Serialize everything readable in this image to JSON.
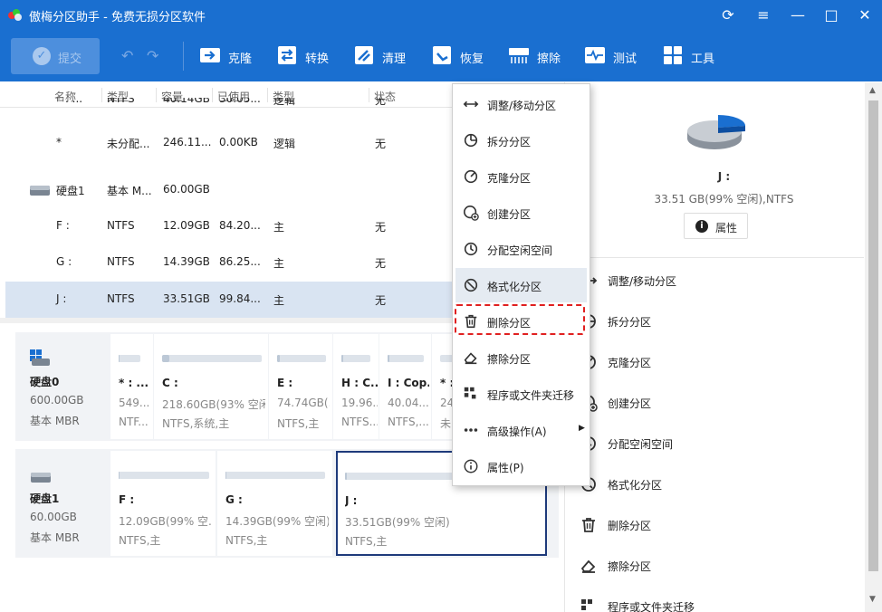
{
  "window": {
    "title": "傲梅分区助手 - 免费无损分区软件",
    "buttons": [
      "⟳",
      "≡",
      "—",
      "□",
      "✕"
    ]
  },
  "toolbar": {
    "submit": "提交",
    "items": [
      "克隆",
      "转换",
      "清理",
      "恢复",
      "擦除",
      "测试",
      "工具"
    ]
  },
  "table": {
    "headers": [
      "名称",
      "类型",
      "容量",
      "已使用",
      "类型",
      "状态"
    ],
    "partial_row": {
      "name": "* : ...",
      "type": "NTFS",
      "cap": "40.14GB",
      "used": "30.05...",
      "ptype": "逻辑",
      "status": "无"
    },
    "rows": [
      {
        "name": "*",
        "type": "未分配...",
        "cap": "246.11...",
        "used": "0.00KB",
        "ptype": "逻辑",
        "status": "无"
      },
      {
        "name": "硬盘1",
        "type": "基本 M...",
        "cap": "60.00GB",
        "used": "",
        "ptype": "",
        "status": ""
      },
      {
        "name": "F :",
        "type": "NTFS",
        "cap": "12.09GB",
        "used": "84.20...",
        "ptype": "主",
        "status": "无"
      },
      {
        "name": "G :",
        "type": "NTFS",
        "cap": "14.39GB",
        "used": "86.25...",
        "ptype": "主",
        "status": "无"
      },
      {
        "name": "J :",
        "type": "NTFS",
        "cap": "33.51GB",
        "used": "99.84...",
        "ptype": "主",
        "status": "无"
      }
    ]
  },
  "disk0": {
    "name": "硬盘0",
    "size": "600.00GB",
    "type": "基本 MBR",
    "parts": [
      {
        "name": "* : ...",
        "size": "549...",
        "fs": "NTF...",
        "used_fraction": 0.05
      },
      {
        "name": "C :",
        "size": "218.60GB(93% 空闲)",
        "fs": "NTFS,系统,主",
        "used_fraction": 0.07
      },
      {
        "name": "E :",
        "size": "74.74GB(...",
        "fs": "NTFS,主",
        "used_fraction": 0.05
      },
      {
        "name": "H : C...",
        "size": "19.96...",
        "fs": "NTFS...",
        "used_fraction": 0.05
      },
      {
        "name": "I : Cop...",
        "size": "40.04...",
        "fs": "NTFS,...",
        "used_fraction": 0.05
      },
      {
        "name": "* :",
        "size": "24...",
        "fs": "未...",
        "used_fraction": 0.0
      }
    ]
  },
  "disk1": {
    "name": "硬盘1",
    "size": "60.00GB",
    "type": "基本 MBR",
    "parts": [
      {
        "name": "F :",
        "size": "12.09GB(99% 空...",
        "fs": "NTFS,主",
        "used_fraction": 0.01
      },
      {
        "name": "G :",
        "size": "14.39GB(99% 空闲)",
        "fs": "NTFS,主",
        "used_fraction": 0.01
      },
      {
        "name": "J :",
        "size": "33.51GB(99% 空闲)",
        "fs": "NTFS,主",
        "used_fraction": 0.01
      }
    ]
  },
  "context_menu": {
    "items": [
      "调整/移动分区",
      "拆分分区",
      "克隆分区",
      "创建分区",
      "分配空闲空间",
      "格式化分区",
      "删除分区",
      "擦除分区",
      "程序或文件夹迁移",
      "高级操作(A)",
      "属性(P)"
    ]
  },
  "right_panel": {
    "name": "J :",
    "info": "33.51 GB(99% 空闲),NTFS",
    "prop_btn": "属性",
    "ops": [
      "调整/移动分区",
      "拆分分区",
      "克隆分区",
      "创建分区",
      "分配空闲空间",
      "格式化分区",
      "删除分区",
      "擦除分区",
      "程序或文件夹迁移"
    ]
  },
  "colors": {
    "brand": "#1a6fd0",
    "selection": "#d9e4f2",
    "highlight": "#e02020"
  }
}
